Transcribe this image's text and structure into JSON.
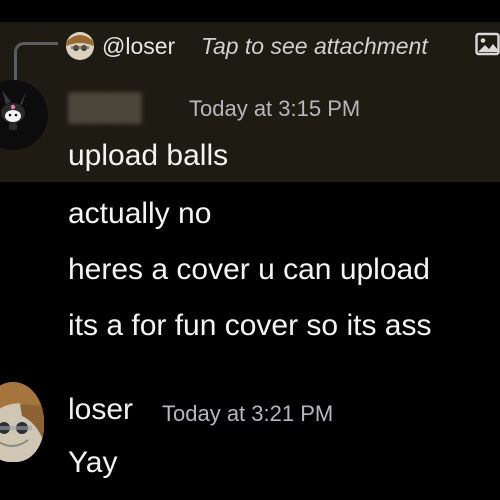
{
  "reply": {
    "username": "@loser",
    "preview": "Tap to see attachment",
    "attachment_icon": "image-icon"
  },
  "message1": {
    "timestamp": "Today at 3:15 PM",
    "lines": [
      "upload balls",
      "actually no",
      "heres a cover u can upload",
      "its a for fun cover so its ass"
    ]
  },
  "message2": {
    "username": "loser",
    "timestamp": "Today at 3:21 PM",
    "text": "Yay"
  },
  "colors": {
    "background": "#000000",
    "highlight": "#1e1b12",
    "text": "#f4f4f4",
    "timestamp": "#b5b7bd"
  }
}
